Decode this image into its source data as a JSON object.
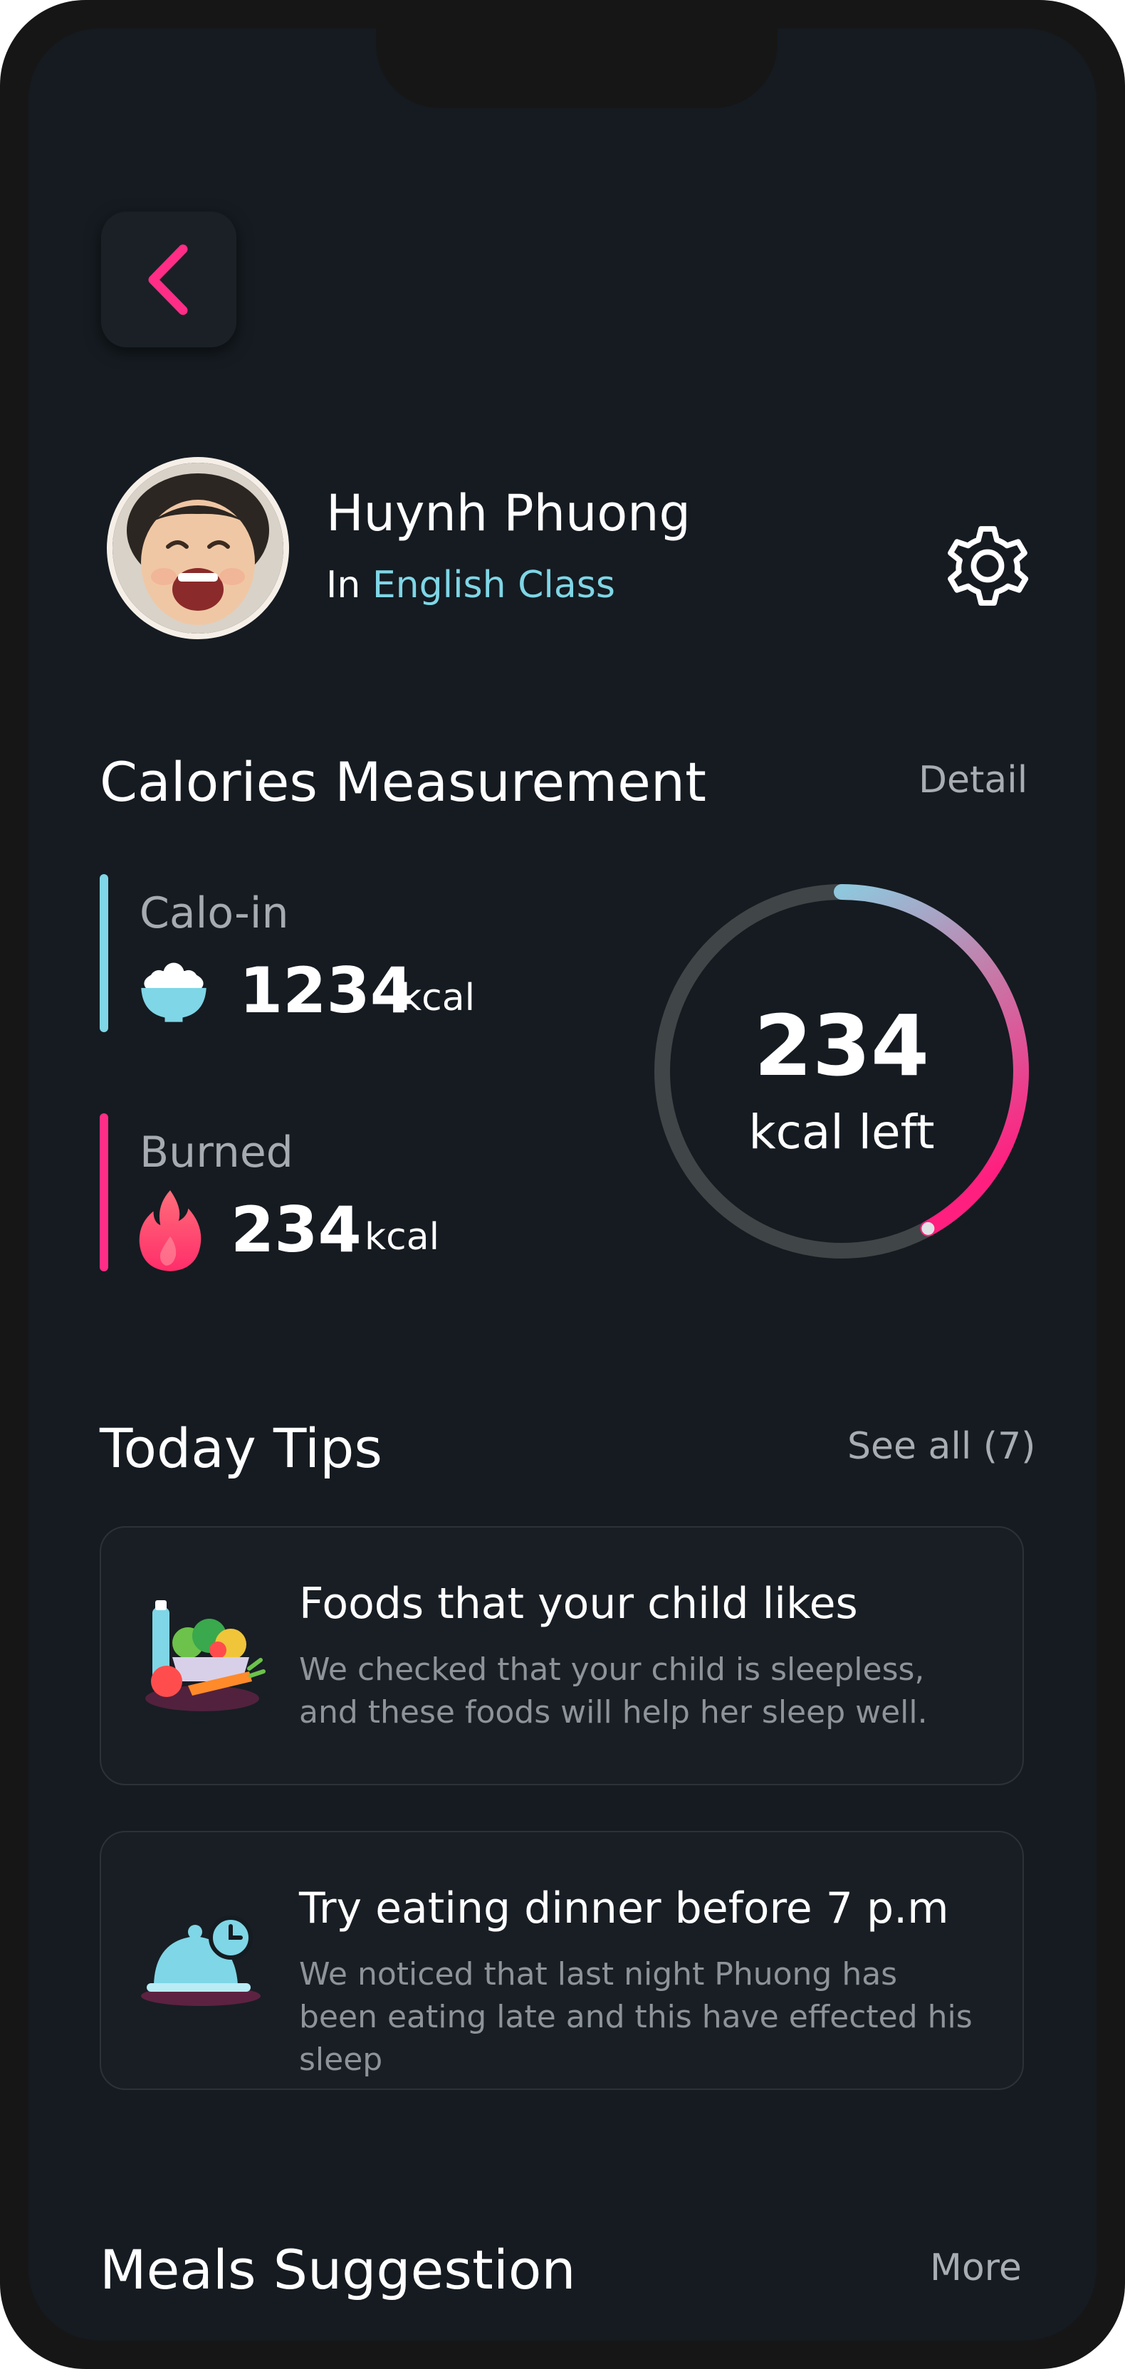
{
  "profile": {
    "name": "Huynh Phuong",
    "class_prefix": "In",
    "class_name": "English Class"
  },
  "calories": {
    "title": "Calories Measurement",
    "detail_link": "Detail",
    "calo_in": {
      "label": "Calo-in",
      "value": "1234",
      "unit": "kcal"
    },
    "burned": {
      "label": "Burned",
      "value": "234",
      "unit": "kcal"
    },
    "ring": {
      "value": "234",
      "label": "kcal left",
      "progress_fraction": 0.42
    }
  },
  "tips": {
    "title": "Today Tips",
    "see_all": "See all (7)",
    "items": [
      {
        "title": "Foods that your child likes",
        "description": "We checked that your child is sleepless, and these foods will help her sleep well.",
        "icon": "food-basket-icon"
      },
      {
        "title": "Try eating dinner before 7 p.m",
        "description": "We noticed that last night Phuong has been eating late and this have effected his sleep",
        "icon": "dinner-clock-icon"
      }
    ]
  },
  "meals": {
    "title": "Meals Suggestion",
    "more_link": "More"
  },
  "colors": {
    "accent_pink": "#ff2d86",
    "accent_cyan": "#7fd6e6",
    "background": "#151b21"
  }
}
